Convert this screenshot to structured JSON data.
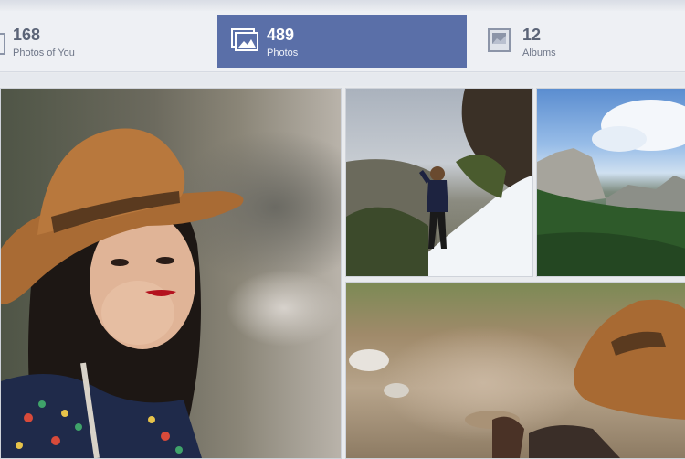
{
  "tabs": {
    "photos_of_you": {
      "count": "168",
      "label": "Photos of You"
    },
    "photos": {
      "count": "489",
      "label": "Photos"
    },
    "albums": {
      "count": "12",
      "label": "Albums"
    }
  },
  "colors": {
    "active_tab": "#5a6fa8",
    "tab_bg": "#eef0f4",
    "page_bg": "#e9ebee"
  },
  "icons": [
    "photo-frame-icon",
    "photos-stack-icon",
    "album-icon"
  ],
  "photos": [
    "portrait-woman-hat",
    "hiker-on-snowy-slope",
    "mountain-valley",
    "person-on-rocks"
  ]
}
